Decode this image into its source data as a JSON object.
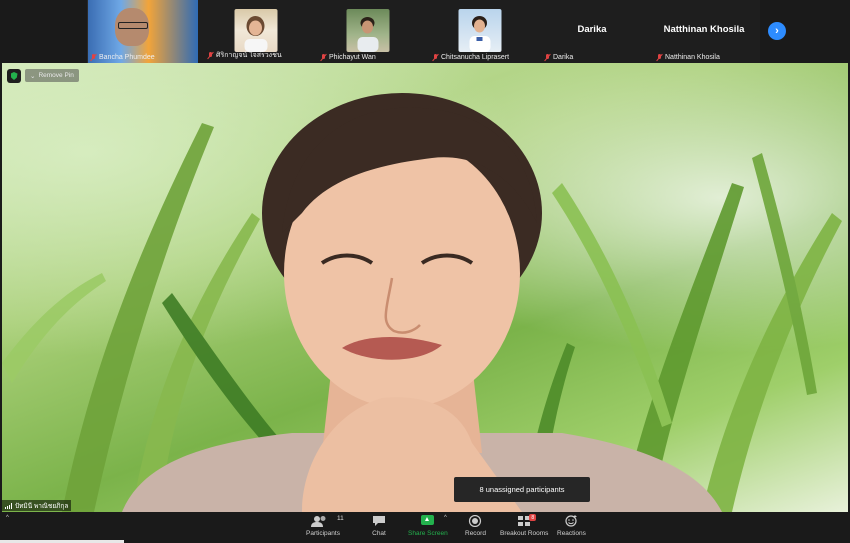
{
  "participants_strip": [
    {
      "name": "Bancha Phumdee",
      "muted": true,
      "photo": "orange-blue-banner"
    },
    {
      "name": "ศิริกาญจน์ ใจสรวงชน",
      "muted": true,
      "photo": "girl-white-shirt"
    },
    {
      "name": "Phichayut Wan",
      "muted": true,
      "photo": "boy-green-bg"
    },
    {
      "name": "Chitsanucha Liprasert",
      "muted": true,
      "photo": "girl-blue-bg"
    },
    {
      "name": "Darika",
      "muted": true,
      "display_name": "Darika"
    },
    {
      "name": "Natthinan Khosila",
      "muted": true,
      "display_name": "Natthinan Khosila"
    }
  ],
  "strip_next_icon": "chevron-right-icon",
  "main_video": {
    "remove_pin_label": "Remove Pin",
    "speaker_name": "ปัทมินี พาณิชยภิกุล",
    "unassigned_text": "8 unassigned participants"
  },
  "toolbar": {
    "participants_label": "Participants",
    "participants_count": "11",
    "chat_label": "Chat",
    "share_label": "Share Screen",
    "record_label": "Record",
    "breakout_label": "Breakout Rooms",
    "breakout_badge": "8",
    "reactions_label": "Reactions",
    "left_caret": "^",
    "share_caret": "^"
  },
  "colors": {
    "accent_blue": "#2d8cff",
    "share_green": "#23b14d",
    "muted_red": "#e04343",
    "toolbar_bg": "#1a1a1a"
  }
}
